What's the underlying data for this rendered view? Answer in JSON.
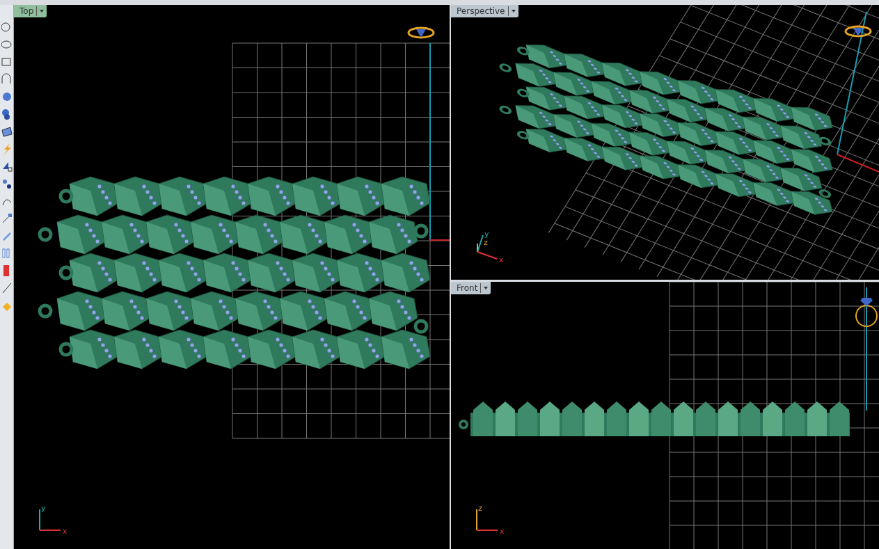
{
  "viewports": [
    {
      "title": "Top",
      "kind": "top",
      "selected": true,
      "axes": [
        "y",
        "x"
      ]
    },
    {
      "title": "Perspective",
      "kind": "perspective",
      "selected": false,
      "axes": [
        "y",
        "z",
        "x"
      ]
    },
    {
      "title": "Front",
      "kind": "front",
      "selected": false,
      "axes": [
        "z",
        "x"
      ]
    }
  ]
}
